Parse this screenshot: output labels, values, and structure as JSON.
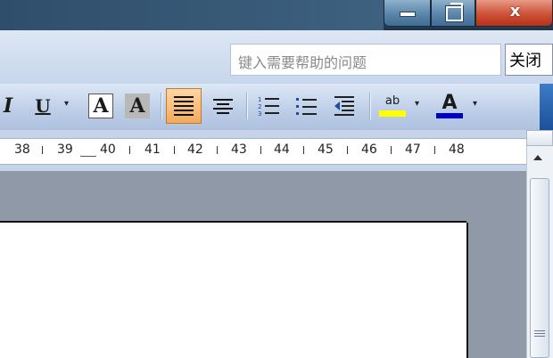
{
  "window": {
    "minimize_icon": "minimize-icon",
    "maximize_icon": "restore-icon",
    "close_glyph": "x"
  },
  "help": {
    "placeholder": "键入需要帮助的问题",
    "close_label": "关闭"
  },
  "toolbar": {
    "italic": "I",
    "underline": "U",
    "char_border": "A",
    "char_shading": "A",
    "highlight_text": "ab",
    "font_color": "A",
    "dropdown_glyph": "▾",
    "colors": {
      "highlight": "#ffff00",
      "font_color": "#0000cc",
      "active_bg": "#f3a95c"
    }
  },
  "ruler": {
    "numbers": [
      "38",
      "39",
      "40",
      "41",
      "42",
      "43",
      "44",
      "45",
      "46",
      "47",
      "48"
    ]
  }
}
